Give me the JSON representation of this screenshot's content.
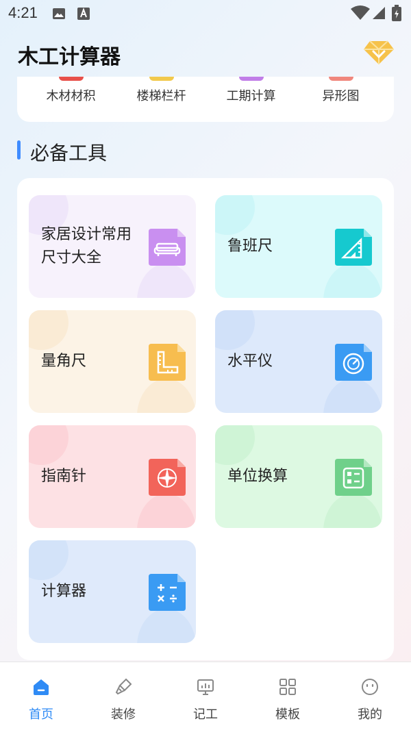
{
  "status_bar": {
    "time": "4:21"
  },
  "header": {
    "title": "木工计算器"
  },
  "categories": [
    {
      "label": "木材材积",
      "color": "#e8504a"
    },
    {
      "label": "楼梯栏杆",
      "color": "#f2c94c"
    },
    {
      "label": "工期计算",
      "color": "#c17ee8"
    },
    {
      "label": "异形图",
      "color": "#f0877d"
    }
  ],
  "section": {
    "title": "必备工具"
  },
  "tools": [
    {
      "label": "家居设计常用尺寸大全",
      "icon": "sofa-icon",
      "bg": "#f7f2fc",
      "accent": "#c98ff0"
    },
    {
      "label": "鲁班尺",
      "icon": "ruler-triangle-icon",
      "bg": "#dcfafb",
      "accent": "#16c9cf"
    },
    {
      "label": "量角尺",
      "icon": "angle-ruler-icon",
      "bg": "#fcf3e6",
      "accent": "#f7bd4f"
    },
    {
      "label": "水平仪",
      "icon": "level-gauge-icon",
      "bg": "#dde9fb",
      "accent": "#3a9bf3"
    },
    {
      "label": "指南针",
      "icon": "compass-icon",
      "bg": "#fde1e4",
      "accent": "#f2645a"
    },
    {
      "label": "单位换算",
      "icon": "unit-convert-icon",
      "bg": "#ddf9e2",
      "accent": "#6fd08a"
    },
    {
      "label": "计算器",
      "icon": "calculator-icon",
      "bg": "#dfeafb",
      "accent": "#3a9bf3"
    }
  ],
  "nav": [
    {
      "label": "首页",
      "icon": "home-icon"
    },
    {
      "label": "装修",
      "icon": "brush-icon"
    },
    {
      "label": "记工",
      "icon": "chart-board-icon"
    },
    {
      "label": "模板",
      "icon": "grid-icon"
    },
    {
      "label": "我的",
      "icon": "smiley-icon"
    }
  ],
  "colors": {
    "accent": "#2f8bf5",
    "nav_inactive": "#999999"
  }
}
